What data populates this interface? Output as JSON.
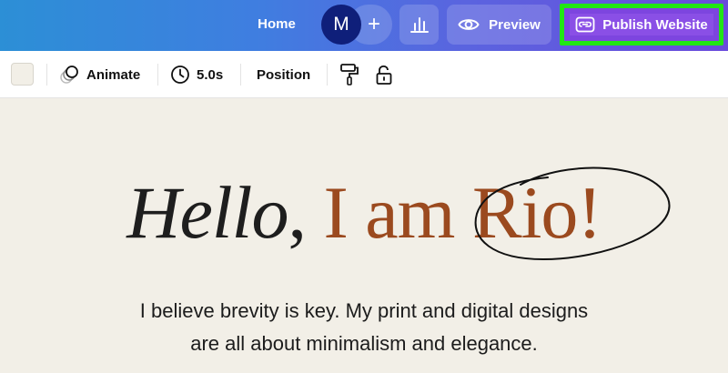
{
  "topbar": {
    "home_label": "Home",
    "avatar_initial": "M",
    "add_label": "+",
    "preview_label": "Preview",
    "publish_label": "Publish Website"
  },
  "toolbar": {
    "animate_label": "Animate",
    "duration_label": "5.0s",
    "position_label": "Position"
  },
  "canvas": {
    "headline_hello": "Hello",
    "headline_comma": ",",
    "headline_rest": " I am Rio!",
    "bio_line1": "I believe brevity is key. My print and digital designs",
    "bio_line2": "are all about minimalism and elegance."
  },
  "colors": {
    "accent": "#9b4a1f",
    "publish_highlight": "#21e614",
    "background": "#f2efe7"
  },
  "icons": [
    "eye-icon",
    "insights-icon",
    "publish-icon",
    "animate-icon",
    "clock-icon",
    "paint-roller-icon",
    "lock-icon"
  ]
}
